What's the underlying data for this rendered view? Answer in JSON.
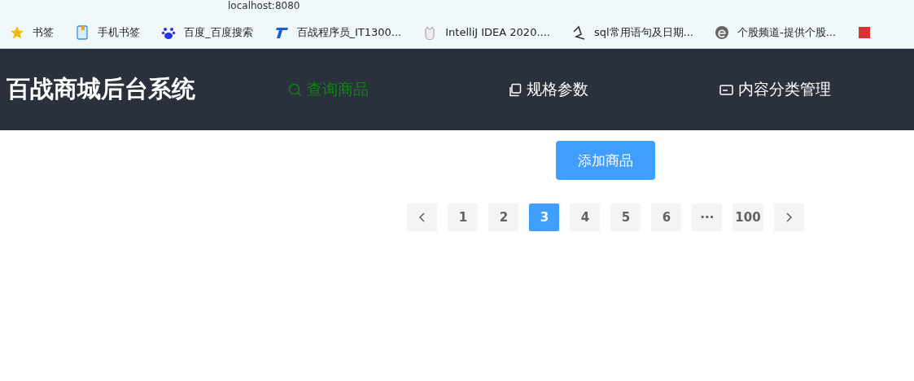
{
  "browser": {
    "address": "localhost:8080",
    "bookmarks": [
      {
        "label": "书签",
        "kind": "star"
      },
      {
        "label": "手机书签",
        "kind": "phone"
      },
      {
        "label": "百度_百度搜索",
        "kind": "paw"
      },
      {
        "label": "百战程序员_IT1300...",
        "kind": "logo"
      },
      {
        "label": "IntelliJ IDEA 2020....",
        "kind": "cat"
      },
      {
        "label": "sql常用语句及日期...",
        "kind": "scribble"
      },
      {
        "label": "个股频道-提供个股...",
        "kind": "circle"
      },
      {
        "kind": "square"
      }
    ]
  },
  "header": {
    "title": "百战商城后台系统",
    "menu": [
      {
        "label": "查询商品",
        "kind": "search",
        "selected": true
      },
      {
        "label": "规格参数",
        "kind": "copy",
        "selected": false
      },
      {
        "label": "内容分类管理",
        "kind": "card",
        "selected": false
      }
    ]
  },
  "add_button": "添加商品",
  "pagination": {
    "pages": [
      {
        "label": "1",
        "selected": false
      },
      {
        "label": "2",
        "selected": false
      },
      {
        "label": "3",
        "selected": true
      },
      {
        "label": "4",
        "selected": false
      },
      {
        "label": "5",
        "selected": false
      },
      {
        "label": "6",
        "selected": false
      },
      {
        "label": "···",
        "selected": false
      },
      {
        "label": "100",
        "selected": false
      }
    ]
  }
}
